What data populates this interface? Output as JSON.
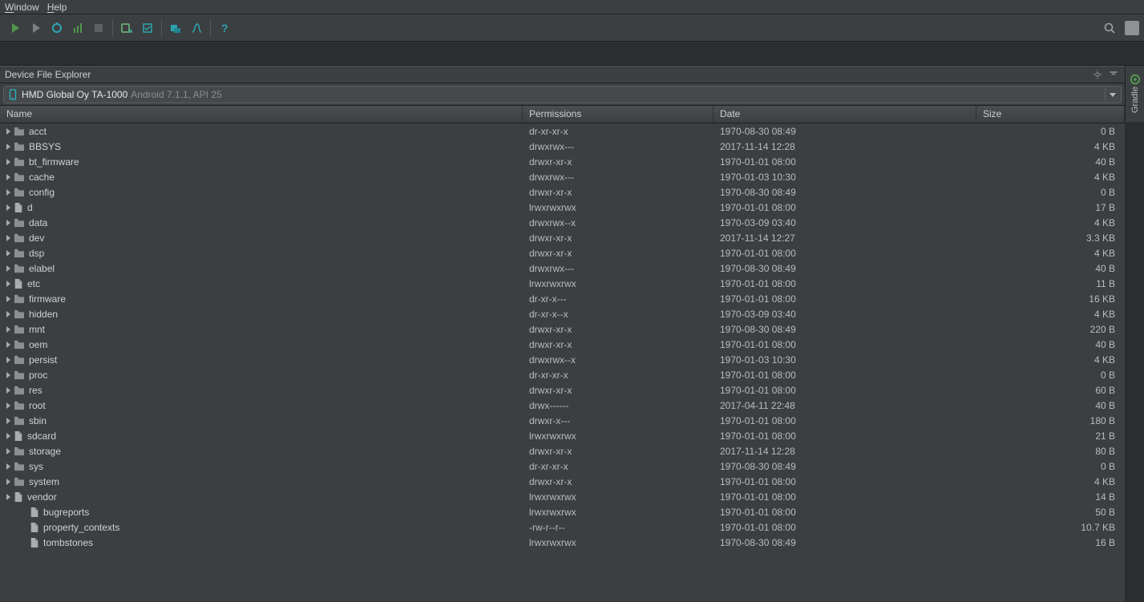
{
  "menubar": {
    "window": "Window",
    "help": "Help"
  },
  "panel": {
    "title": "Device File Explorer"
  },
  "device": {
    "name": "HMD Global Oy TA-1000",
    "subtitle": "Android 7.1.1, API 25"
  },
  "columns": {
    "name": "Name",
    "perm": "Permissions",
    "date": "Date",
    "size": "Size"
  },
  "sidetab": {
    "label": "Gradle"
  },
  "icons": {
    "folder_body": "#7c8084",
    "folder_tab": "#7c8084",
    "file_body": "#7c8084"
  },
  "rows": [
    {
      "name": "acct",
      "type": "folder",
      "expand": true,
      "perm": "dr-xr-xr-x",
      "date": "1970-08-30 08:49",
      "size": "0 B"
    },
    {
      "name": "BBSYS",
      "type": "folder",
      "expand": true,
      "perm": "drwxrwx---",
      "date": "2017-11-14 12:28",
      "size": "4 KB"
    },
    {
      "name": "bt_firmware",
      "type": "folder",
      "expand": true,
      "perm": "drwxr-xr-x",
      "date": "1970-01-01 08:00",
      "size": "40 B"
    },
    {
      "name": "cache",
      "type": "folder",
      "expand": true,
      "perm": "drwxrwx---",
      "date": "1970-01-03 10:30",
      "size": "4 KB"
    },
    {
      "name": "config",
      "type": "folder",
      "expand": true,
      "perm": "drwxr-xr-x",
      "date": "1970-08-30 08:49",
      "size": "0 B"
    },
    {
      "name": "d",
      "type": "file",
      "expand": true,
      "perm": "lrwxrwxrwx",
      "date": "1970-01-01 08:00",
      "size": "17 B"
    },
    {
      "name": "data",
      "type": "folder",
      "expand": true,
      "perm": "drwxrwx--x",
      "date": "1970-03-09 03:40",
      "size": "4 KB"
    },
    {
      "name": "dev",
      "type": "folder",
      "expand": true,
      "perm": "drwxr-xr-x",
      "date": "2017-11-14 12:27",
      "size": "3.3 KB"
    },
    {
      "name": "dsp",
      "type": "folder",
      "expand": true,
      "perm": "drwxr-xr-x",
      "date": "1970-01-01 08:00",
      "size": "4 KB"
    },
    {
      "name": "elabel",
      "type": "folder",
      "expand": true,
      "perm": "drwxrwx---",
      "date": "1970-08-30 08:49",
      "size": "40 B"
    },
    {
      "name": "etc",
      "type": "file",
      "expand": true,
      "perm": "lrwxrwxrwx",
      "date": "1970-01-01 08:00",
      "size": "11 B"
    },
    {
      "name": "firmware",
      "type": "folder",
      "expand": true,
      "perm": "dr-xr-x---",
      "date": "1970-01-01 08:00",
      "size": "16 KB"
    },
    {
      "name": "hidden",
      "type": "folder",
      "expand": true,
      "perm": "dr-xr-x--x",
      "date": "1970-03-09 03:40",
      "size": "4 KB"
    },
    {
      "name": "mnt",
      "type": "folder",
      "expand": true,
      "perm": "drwxr-xr-x",
      "date": "1970-08-30 08:49",
      "size": "220 B"
    },
    {
      "name": "oem",
      "type": "folder",
      "expand": true,
      "perm": "drwxr-xr-x",
      "date": "1970-01-01 08:00",
      "size": "40 B"
    },
    {
      "name": "persist",
      "type": "folder",
      "expand": true,
      "perm": "drwxrwx--x",
      "date": "1970-01-03 10:30",
      "size": "4 KB"
    },
    {
      "name": "proc",
      "type": "folder",
      "expand": true,
      "perm": "dr-xr-xr-x",
      "date": "1970-01-01 08:00",
      "size": "0 B"
    },
    {
      "name": "res",
      "type": "folder",
      "expand": true,
      "perm": "drwxr-xr-x",
      "date": "1970-01-01 08:00",
      "size": "60 B"
    },
    {
      "name": "root",
      "type": "folder",
      "expand": true,
      "perm": "drwx------",
      "date": "2017-04-11 22:48",
      "size": "40 B"
    },
    {
      "name": "sbin",
      "type": "folder",
      "expand": true,
      "perm": "drwxr-x---",
      "date": "1970-01-01 08:00",
      "size": "180 B"
    },
    {
      "name": "sdcard",
      "type": "file",
      "expand": true,
      "perm": "lrwxrwxrwx",
      "date": "1970-01-01 08:00",
      "size": "21 B"
    },
    {
      "name": "storage",
      "type": "folder",
      "expand": true,
      "perm": "drwxr-xr-x",
      "date": "2017-11-14 12:28",
      "size": "80 B"
    },
    {
      "name": "sys",
      "type": "folder",
      "expand": true,
      "perm": "dr-xr-xr-x",
      "date": "1970-08-30 08:49",
      "size": "0 B"
    },
    {
      "name": "system",
      "type": "folder",
      "expand": true,
      "perm": "drwxr-xr-x",
      "date": "1970-01-01 08:00",
      "size": "4 KB"
    },
    {
      "name": "vendor",
      "type": "file",
      "expand": true,
      "perm": "lrwxrwxrwx",
      "date": "1970-01-01 08:00",
      "size": "14 B"
    },
    {
      "name": "bugreports",
      "type": "file",
      "expand": false,
      "indent": 1,
      "perm": "lrwxrwxrwx",
      "date": "1970-01-01 08:00",
      "size": "50 B"
    },
    {
      "name": "property_contexts",
      "type": "file",
      "expand": false,
      "indent": 1,
      "perm": "-rw-r--r--",
      "date": "1970-01-01 08:00",
      "size": "10.7 KB"
    },
    {
      "name": "tombstones",
      "type": "file",
      "expand": false,
      "indent": 1,
      "perm": "lrwxrwxrwx",
      "date": "1970-08-30 08:49",
      "size": "16 B"
    }
  ]
}
